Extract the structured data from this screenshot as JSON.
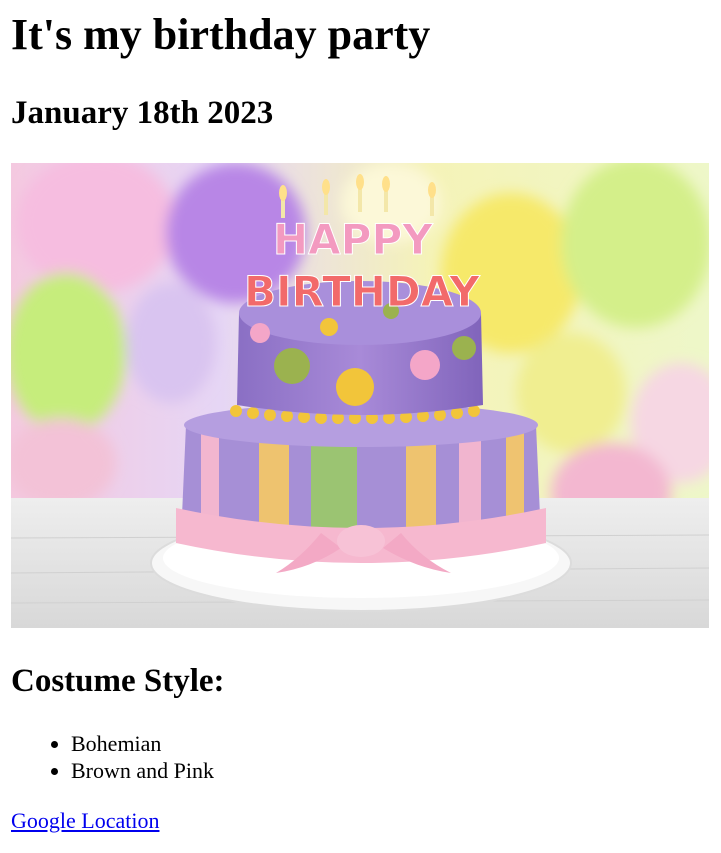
{
  "page": {
    "title": "It's my birthday party",
    "date": "January 18th 2023"
  },
  "image": {
    "cake_topper_line1": "HAPPY",
    "cake_topper_line2": "BIRTHDAY"
  },
  "costume": {
    "heading": "Costume Style:",
    "items": [
      "Bohemian",
      "Brown and Pink"
    ]
  },
  "location": {
    "link_text": "Google Location"
  },
  "colors": {
    "link": "#0000ee",
    "cake_top": "#9b7fd0",
    "ribbon": "#f6b8cf"
  }
}
